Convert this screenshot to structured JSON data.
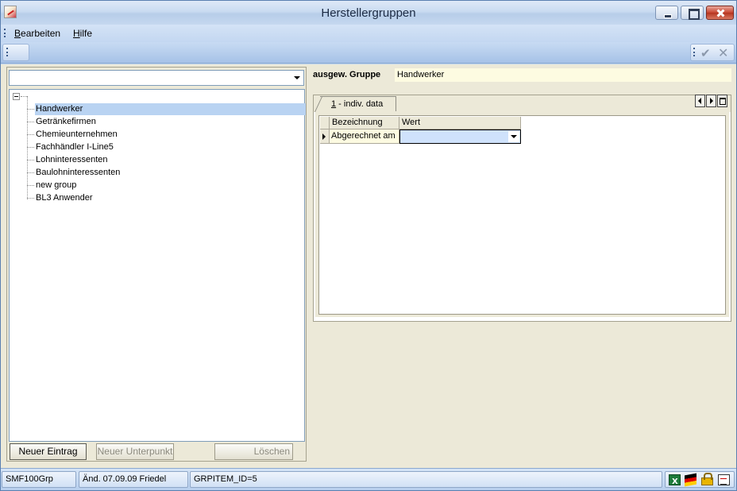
{
  "window": {
    "title": "Herstellergruppen"
  },
  "menu": {
    "bearbeiten": {
      "accel": "B",
      "rest": "earbeiten"
    },
    "hilfe": {
      "accel": "H",
      "rest": "ilfe"
    }
  },
  "tree": {
    "items": [
      {
        "label": "Handwerker",
        "selected": true
      },
      {
        "label": "Getränkefirmen"
      },
      {
        "label": "Chemieunternehmen"
      },
      {
        "label": "Fachhändler I-Line5"
      },
      {
        "label": "Lohninteressenten"
      },
      {
        "label": "Baulohninteressenten"
      },
      {
        "label": "new group"
      },
      {
        "label": "BL3 Anwender"
      }
    ]
  },
  "buttons": {
    "new_entry": "Neuer Eintrag",
    "new_subitem": "Neuer Unterpunkt",
    "delete": "Löschen"
  },
  "group": {
    "label": "ausgew. Gruppe",
    "value": "Handwerker"
  },
  "tabs": [
    {
      "accel": "1",
      "rest": " - indiv. data"
    }
  ],
  "grid": {
    "columns": [
      "Bezeichnung",
      "Wert"
    ],
    "rows": [
      {
        "bezeichnung": "Abgerechnet am",
        "wert": ""
      }
    ]
  },
  "status": {
    "module": "SMF100Grp",
    "changed": "Änd. 07.09.09 Friedel",
    "record": "GRPITEM_ID=5"
  },
  "icons": {
    "status": [
      "excel-icon",
      "german-flag-icon",
      "lock-icon",
      "document-icon"
    ]
  }
}
